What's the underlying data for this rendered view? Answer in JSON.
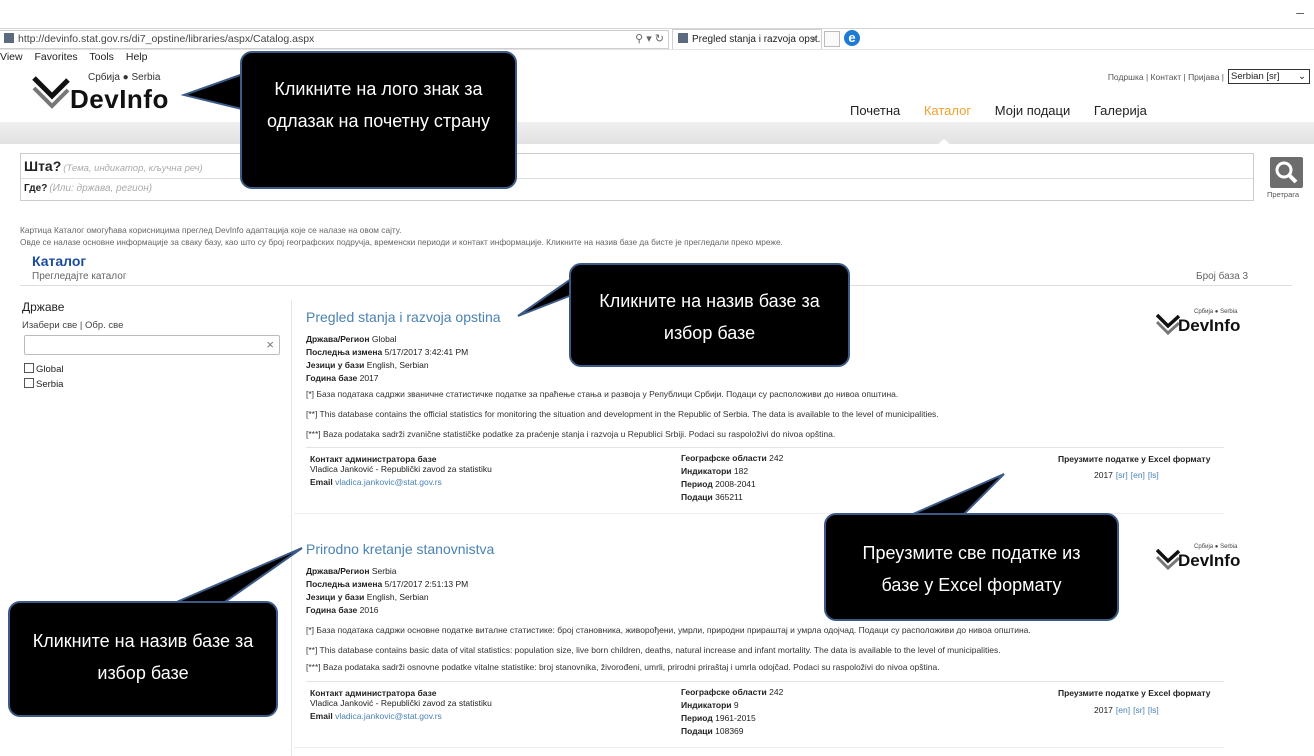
{
  "browser": {
    "url": "http://devinfo.stat.gov.rs/di7_opstine/libraries/aspx/Catalog.aspx",
    "url_controls": "⚲ ▾ ↻",
    "tab_title": "Pregled stanja i razvoja opst...",
    "tab_close": "×",
    "minimize": "–",
    "menu": [
      "View",
      "Favorites",
      "Tools",
      "Help"
    ]
  },
  "header": {
    "logo_serbia": "Србија ● Serbia",
    "logo_devinfo": "DevInfo",
    "top_links": "Подршка | Контакт | Пријава |",
    "language": "Serbian [sr]",
    "nav": [
      "Почетна",
      "Каталог",
      "Моји подаци",
      "Галерија"
    ]
  },
  "search": {
    "what_label": "Шта?",
    "what_placeholder": "(Тема, индикатор, кључна реч)",
    "where_label": "Где?",
    "where_placeholder": "(Или: држава, регион)",
    "button_label": "Претрага"
  },
  "intro": {
    "line1": "Картица Каталог омогућава корисницима преглед DevInfo адаптација које се налазе на овом сајту.",
    "line2": "Овде се налазе основне информације за сваку базу, као што су број географских подручја, временски периоди и контакт информације. Кликните на назив базе да бисте је прегледали преко мреже."
  },
  "catalog": {
    "title": "Каталог",
    "subtitle": "Прегледајте каталог",
    "count_label": "Број база 3"
  },
  "sidebar": {
    "title": "Државе",
    "links": "Изабери све | Обр. све",
    "clear": "×",
    "options": [
      "Global",
      "Serbia"
    ]
  },
  "labels": {
    "region": "Држава/Регион",
    "modified": "Последња измена",
    "languages": "Језици у бази",
    "year": "Година базе",
    "contact": "Контакт администратора базе",
    "email": "Email",
    "areas": "Географске области",
    "indicators": "Индикатори",
    "period": "Период",
    "data": "Подаци",
    "download": "Преузмите податке у Excel формату"
  },
  "databases": [
    {
      "title": "Pregled stanja i razvoja opstina",
      "region": "Global",
      "modified": "5/17/2017 3:42:41 PM",
      "languages": "English, Serbian",
      "year": "2017",
      "desc1": "[*] База података садржи званичне статистичке податке за праћење стања и развоја у Републици Србији. Подаци су расположиви до нивоа општина.",
      "desc2": "[**] This database contains the official statistics for monitoring the situation and development in the Republic of Serbia. The data is available to the level of municipalities.",
      "desc3": "[***] Baza podataka sadrži zvanične statističke podatke za praćenje stanja i razvoja u Republici Srbiji. Podaci su raspoloživi do nivoa opština.",
      "contact_name": "Vladica Janković - Republički zavod za statistiku",
      "email": "vladica.jankovic@stat.gov.rs",
      "areas": "242",
      "indicators": "182",
      "period": "2008-2041",
      "data": "365211",
      "dl_year": "2017",
      "dl_links": [
        "[sr]",
        "[en]",
        "[ls]"
      ]
    },
    {
      "title": "Prirodno kretanje stanovnistva",
      "region": "Serbia",
      "modified": "5/17/2017 2:51:13 PM",
      "languages": "English, Serbian",
      "year": "2016",
      "desc1": "[*] База података садржи основне податке виталне статистике: број становника, живорођени, умрли, природни прираштај и умрла одојчад. Подаци су расположиви до нивоа општина.",
      "desc2": "[**] This database contains basic data of vital statistics: population size, live born children, deaths, natural increase and infant mortality. The data is available to the level of municipalities.",
      "desc3": "[***] Baza podataka sadrži osnovne podatke vitalne statistike: broj stanovnika, živorođeni, umrli, prirodni priraštaj i umrla odojčad. Podaci su raspoloživi do nivoa opština.",
      "contact_name": "Vladica Janković - Republički zavod za statistiku",
      "email": "vladica.jankovic@stat.gov.rs",
      "areas": "242",
      "indicators": "9",
      "period": "1961-2015",
      "data": "108369",
      "dl_year": "2017",
      "dl_links": [
        "[en]",
        "[sr]",
        "[ls]"
      ]
    }
  ],
  "callouts": {
    "logo": "Кликните на лого знак за одлазак на почетну страну",
    "title1": "Кликните на назив базе за избор базе",
    "excel": "Преузмите све податке из базе у Excel формату",
    "title2": "Кликните на назив базе за избор базе"
  },
  "colors": {
    "accent_nav": "#f0a030",
    "link": "#4a82b4",
    "catalog_title": "#1a4c9c",
    "callout_bg": "#000000",
    "callout_border": "#3c5a87"
  }
}
